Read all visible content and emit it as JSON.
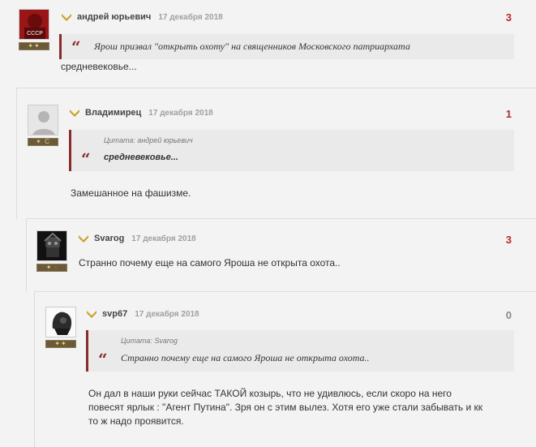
{
  "comments": [
    {
      "author": "андрей юрьевич",
      "date": "17 декабря 2018",
      "score": "3",
      "avatar_text": "СССР",
      "rank_icons": "✦✦",
      "quote_text": "Ярош призвал \"открыть охоту\" на священников Московского патриархата",
      "text": "средневековье..."
    },
    {
      "author": "Владимирец",
      "date": "17 декабря 2018",
      "score": "1",
      "rank_icons": "✶ C",
      "quote_cite": "Цитата: андрей юрьевич",
      "quote_text": "средневековье...",
      "text": "Замешанное на фашизме."
    },
    {
      "author": "Svarog",
      "date": "17 декабря 2018",
      "score": "3",
      "rank_icons": "✦ ·",
      "text": "Странно почему еще на самого Яроша не открыта охота.."
    },
    {
      "author": "svp67",
      "date": "17 декабря 2018",
      "score": "0",
      "rank_icons": "✦✦",
      "quote_cite": "Цитата: Svarog",
      "quote_text": "Странно почему еще на самого Яроша не открыта охота..",
      "text_lines": [
        "Он дал в наши руки сейчас ТАКОЙ козырь, что не удивлюсь, если скоро на него",
        "повесят ярлык : \"Агент Путина\". Зря он с этим вылез. Хотя его уже стали забывать и кк",
        "то ж надо проявится."
      ]
    }
  ],
  "colors": {
    "accent": "#b42b2b",
    "quote_border": "#8b2a2a",
    "chevron": "#c9a227"
  },
  "icons": {
    "rank_chevron": "chevron-rank-icon",
    "quote_mark": "“"
  }
}
